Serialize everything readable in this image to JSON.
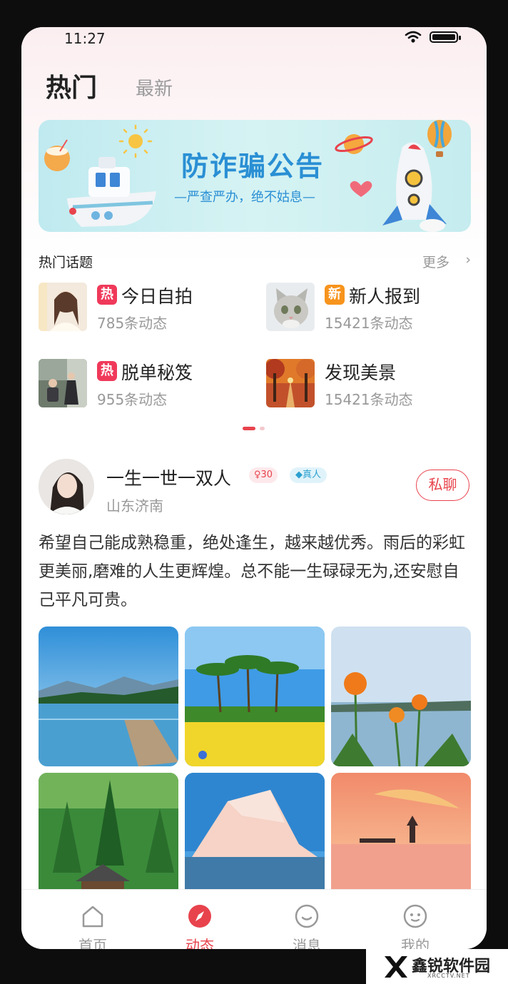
{
  "status_bar": {
    "time": "11:27"
  },
  "header": {
    "tabs": [
      {
        "label": "热门",
        "active": true
      },
      {
        "label": "最新",
        "active": false
      }
    ]
  },
  "banner": {
    "title": "防诈骗公告",
    "subtitle": "—严查严办，绝不姑息—"
  },
  "topics_section": {
    "title": "热门话题",
    "more_label": "更多",
    "items": [
      {
        "tag": "热",
        "tag_color": "#f0395a",
        "name": "今日自拍",
        "count": "785条动态"
      },
      {
        "tag": "新",
        "tag_color": "#f7941d",
        "name": "新人报到",
        "count": "15421条动态"
      },
      {
        "tag": "热",
        "tag_color": "#f0395a",
        "name": "脱单秘笈",
        "count": "955条动态"
      },
      {
        "tag": "",
        "tag_color": "",
        "name": "发现美景",
        "count": "15421条动态"
      }
    ]
  },
  "post": {
    "username": "一生一世一双人",
    "level_badge": "30",
    "verified_badge": "真人",
    "location": "山东济南",
    "chat_button": "私聊",
    "text": "希望自己能成熟稳重，绝处逢生，越来越优秀。雨后的彩虹更美丽,磨难的人生更辉煌。总不能一生碌碌无为,还安慰自己平凡可贵。",
    "photos": [
      "lake-pier",
      "palm-trees",
      "orange-flowers",
      "forest-cabin",
      "iceberg",
      "sunset-pagoda"
    ]
  },
  "tab_bar": {
    "items": [
      {
        "label": "首页",
        "icon": "home-icon",
        "active": false
      },
      {
        "label": "动态",
        "icon": "compass-icon",
        "active": true
      },
      {
        "label": "消息",
        "icon": "message-icon",
        "active": false
      },
      {
        "label": "我的",
        "icon": "profile-icon",
        "active": false
      }
    ]
  },
  "watermark": {
    "title": "鑫锐软件园",
    "subtitle": "XRCCTV.NET"
  },
  "colors": {
    "accent": "#e8434d",
    "banner_text": "#2a8fd4"
  }
}
